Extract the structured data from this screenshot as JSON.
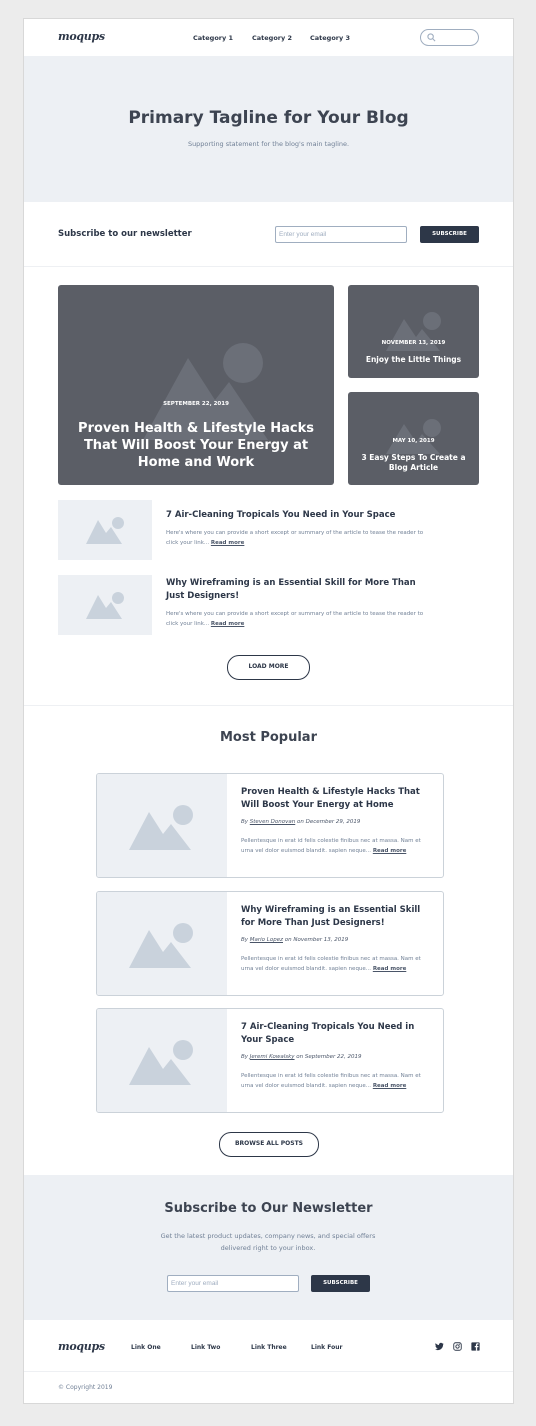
{
  "header": {
    "logo": "moqups",
    "nav": [
      "Category 1",
      "Category 2",
      "Category 3"
    ]
  },
  "hero": {
    "title": "Primary Tagline for Your Blog",
    "subtitle": "Supporting statement for the blog's main tagline."
  },
  "newsletter_row": {
    "label": "Subscribe to our newsletter",
    "placeholder": "Enter your email",
    "button": "SUBSCRIBE"
  },
  "featured": {
    "main": {
      "date": "SEPTEMBER 22, 2019",
      "title": "Proven Health & Lifestyle Hacks That Will Boost Your Energy at Home and Work"
    },
    "side": [
      {
        "date": "NOVEMBER 13, 2019",
        "title": "Enjoy the Little Things"
      },
      {
        "date": "MAY 10, 2019",
        "title": "3 Easy Steps To Create a Blog Article"
      }
    ]
  },
  "posts": [
    {
      "title": "7 Air-Cleaning Tropicals You Need in Your Space",
      "excerpt": "Here's where you can provide a short except or summary of the article to tease the reader to click your link...",
      "read_more": "Read more"
    },
    {
      "title": "Why Wireframing is an Essential Skill for More Than Just Designers!",
      "excerpt": "Here's where you can provide a short except or summary of the article to tease the reader to click your link...",
      "read_more": "Read more"
    }
  ],
  "load_more": "LOAD MORE",
  "popular": {
    "heading": "Most Popular",
    "items": [
      {
        "title": "Proven Health & Lifestyle Hacks That Will Boost Your Energy at Home",
        "by": "By",
        "author": "Steven Donovan",
        "on": "on December 29, 2019",
        "excerpt": "Pellentesque in erat id felis colestie finibus nec at massa. Nam et urna vel dolor euismod blandit. sapien neque...",
        "read_more": "Read more"
      },
      {
        "title": "Why Wireframing is an Essential Skill for More Than Just Designers!",
        "by": "By",
        "author": "Mario Lopez",
        "on": "on November 13, 2019",
        "excerpt": "Pellentesque in erat id felis colestie finibus nec at massa. Nam et urna vel dolor euismod blandit. sapien neque...",
        "read_more": "Read more"
      },
      {
        "title": "7 Air-Cleaning Tropicals You Need in Your Space",
        "by": "By",
        "author": "Jeremi Kowalsky",
        "on": "on September 22, 2019",
        "excerpt": "Pellentesque in erat id felis colestie finibus nec at massa. Nam et urna vel dolor euismod blandit. sapien neque...",
        "read_more": "Read more"
      }
    ],
    "browse_all": "BROWSE ALL POSTS"
  },
  "newsletter_block": {
    "title": "Subscribe to Our Newsletter",
    "subtitle": "Get the latest product updates, company news, and special offers delivered right to your inbox.",
    "placeholder": "Enter your email",
    "button": "SUBSCRIBE"
  },
  "footer": {
    "logo": "moqups",
    "links": [
      "Link One",
      "Link Two",
      "Link Three",
      "Link Four"
    ],
    "social_icons": [
      "twitter-icon",
      "instagram-icon",
      "facebook-icon"
    ],
    "copyright": "© Copyright 2019"
  },
  "colors": {
    "primary_dark": "#2d3748",
    "hero_bg": "#edf0f4",
    "card_dark": "#5b5e66",
    "placeholder_shape": "#c9d2dc"
  }
}
